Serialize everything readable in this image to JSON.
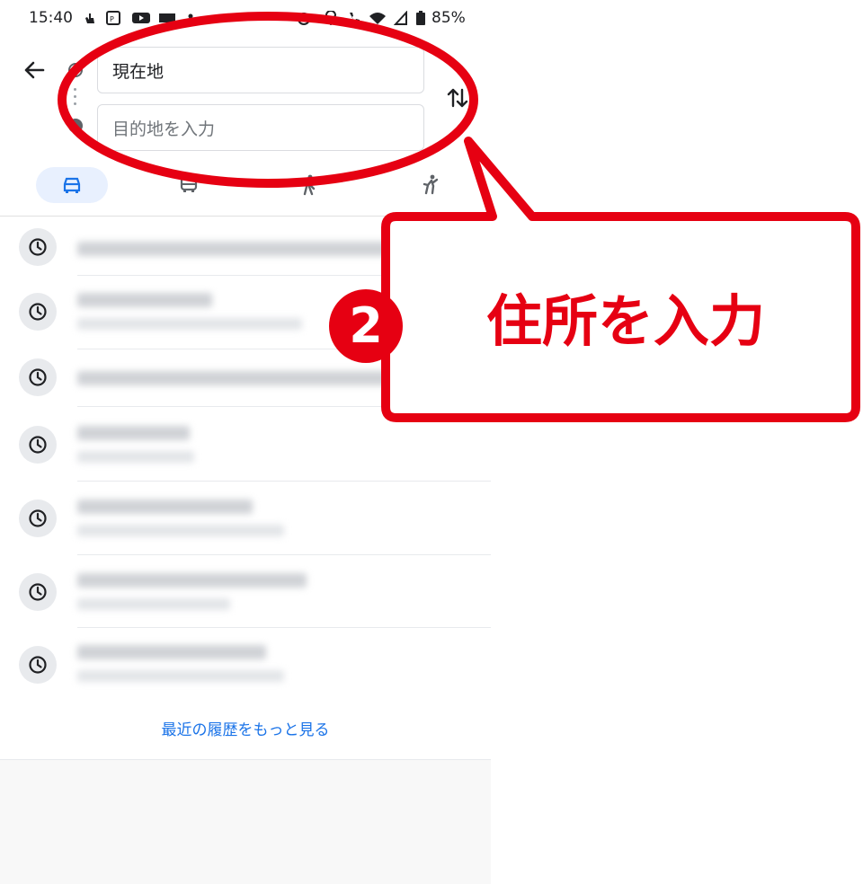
{
  "status_bar": {
    "time": "15:40",
    "battery": "85%"
  },
  "directions": {
    "origin_value": "現在地",
    "destination_placeholder": "目的地を入力"
  },
  "travel_modes": [
    {
      "icon": "car-icon",
      "selected": true
    },
    {
      "icon": "transit-icon",
      "selected": false
    },
    {
      "icon": "walk-icon",
      "selected": false
    },
    {
      "icon": "ride-icon",
      "selected": false
    }
  ],
  "history": {
    "items_count_note": "recent search entries (text blurred in screenshot)",
    "more_link": "最近の履歴をもっと見る"
  },
  "annotation": {
    "step_number": "2",
    "label": "住所を入力",
    "accent_color": "#e60012"
  }
}
